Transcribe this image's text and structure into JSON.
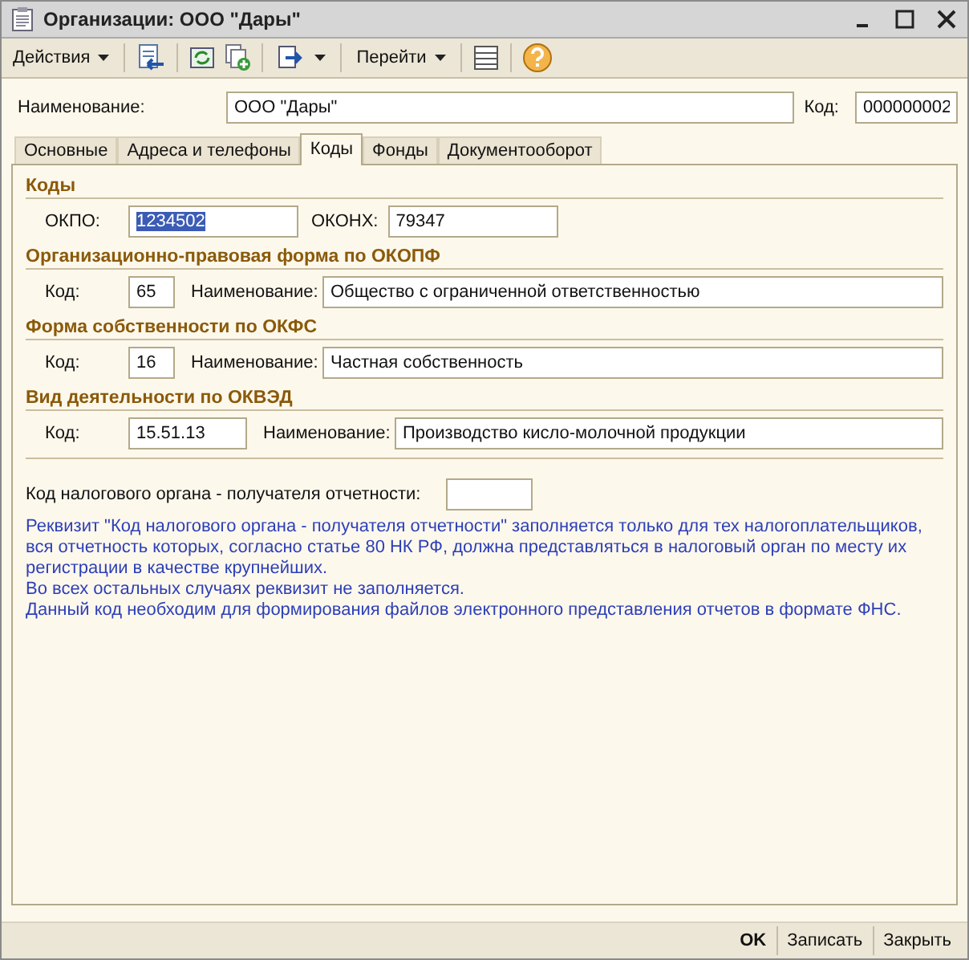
{
  "window": {
    "title": "Организации: ООО \"Дары\""
  },
  "toolbar": {
    "actions_menu": "Действия",
    "goto_menu": "Перейти"
  },
  "header": {
    "name_label": "Наименование:",
    "name_value": "ООО \"Дары\"",
    "code_label": "Код:",
    "code_value": "000000002"
  },
  "tabs": [
    {
      "label": "Основные",
      "selected": false
    },
    {
      "label": "Адреса и телефоны",
      "selected": false
    },
    {
      "label": "Коды",
      "selected": true
    },
    {
      "label": "Фонды",
      "selected": false
    },
    {
      "label": "Документооборот",
      "selected": false
    }
  ],
  "sections": [
    {
      "title": "Коды",
      "kind": "pair",
      "fields": [
        {
          "label": "ОКПО:",
          "value": "1234502",
          "selected": true
        },
        {
          "label": "ОКОНХ:",
          "value": "79347",
          "selected": false
        }
      ]
    },
    {
      "title": "Организационно-правовая форма по ОКОПФ",
      "kind": "code_name",
      "fields": [
        {
          "label": "Код:",
          "value": "65",
          "selected": false
        },
        {
          "label": "Наименование:",
          "value": "Общество с ограниченной ответственностью",
          "selected": false
        }
      ]
    },
    {
      "title": "Форма собственности по ОКФС",
      "kind": "code_name",
      "fields": [
        {
          "label": "Код:",
          "value": "16",
          "selected": false
        },
        {
          "label": "Наименование:",
          "value": "Частная собственность",
          "selected": false
        }
      ]
    },
    {
      "title": "Вид деятельности по ОКВЭД",
      "kind": "code_name",
      "fields": [
        {
          "label": "Код:",
          "value": "15.51.13",
          "selected": false
        },
        {
          "label": "Наименование:",
          "value": "Производство кисло-молочной продукции",
          "selected": false
        }
      ]
    }
  ],
  "tax": {
    "label": "Код налогового органа - получателя отчетности:"
  },
  "notes": [
    "Реквизит \"Код налогового органа - получателя отчетности\" заполняется только для тех налогоплательщиков, вся отчетность которых, согласно статье 80 НК РФ, должна представляться в налоговый орган по месту их регистрации в качестве крупнейших.",
    "Во всех остальных случаях реквизит не заполняется.",
    "Данный код необходим для формирования файлов электронного представления отчетов в формате ФНС."
  ],
  "buttons": [
    {
      "label": "OK",
      "kind": "default"
    },
    {
      "label": "Записать",
      "kind": "normal"
    },
    {
      "label": "Закрыть",
      "kind": "normal"
    }
  ]
}
